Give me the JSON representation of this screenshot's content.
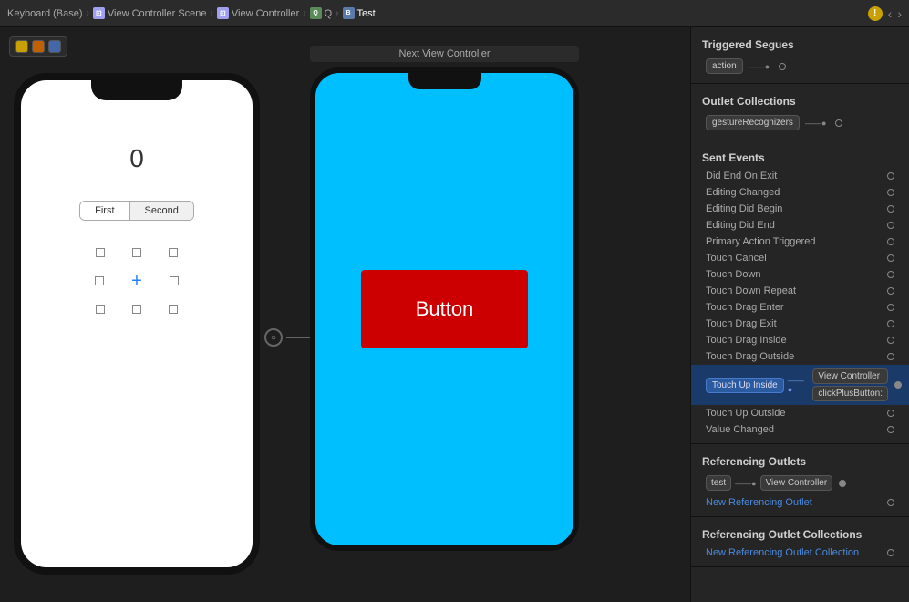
{
  "breadcrumb": {
    "items": [
      {
        "label": "Keyboard (Base)",
        "icon": null,
        "type": "plain"
      },
      {
        "label": "View Controller Scene",
        "icon": "vc",
        "type": "vc"
      },
      {
        "label": "View Controller",
        "icon": "vc",
        "type": "vc"
      },
      {
        "label": "Q",
        "icon": "q",
        "type": "q"
      },
      {
        "label": "Test",
        "icon": "b",
        "type": "b"
      }
    ]
  },
  "phone1": {
    "label_zero": "0",
    "seg_first": "First",
    "seg_second": "Second"
  },
  "phone2": {
    "header_label": "Next View Controller",
    "button_label": "Button"
  },
  "right_panel": {
    "triggered_segues_header": "Triggered Segues",
    "action_label": "action",
    "outlet_collections_header": "Outlet Collections",
    "gesture_recognizers": "gestureRecognizers",
    "sent_events_header": "Sent Events",
    "events": [
      "Did End On Exit",
      "Editing Changed",
      "Editing Did Begin",
      "Editing Did End",
      "Primary Action Triggered",
      "Touch Cancel",
      "Touch Down",
      "Touch Down Repeat",
      "Touch Drag Enter",
      "Touch Drag Exit",
      "Touch Drag Inside",
      "Touch Drag Outside",
      "Touch Up Inside",
      "Touch Up Outside",
      "Value Changed"
    ],
    "touch_up_inside": "Touch Up Inside",
    "touch_up_conn1": "View Controller",
    "touch_up_conn2": "clickPlusButton:",
    "referencing_outlets_header": "Referencing Outlets",
    "ref_outlet": "test",
    "ref_outlet_conn": "View Controller",
    "new_ref_outlet": "New Referencing Outlet",
    "referencing_outlet_collections_header": "Referencing Outlet Collections",
    "new_ref_outlet_coll": "New Referencing Outlet Collection"
  }
}
